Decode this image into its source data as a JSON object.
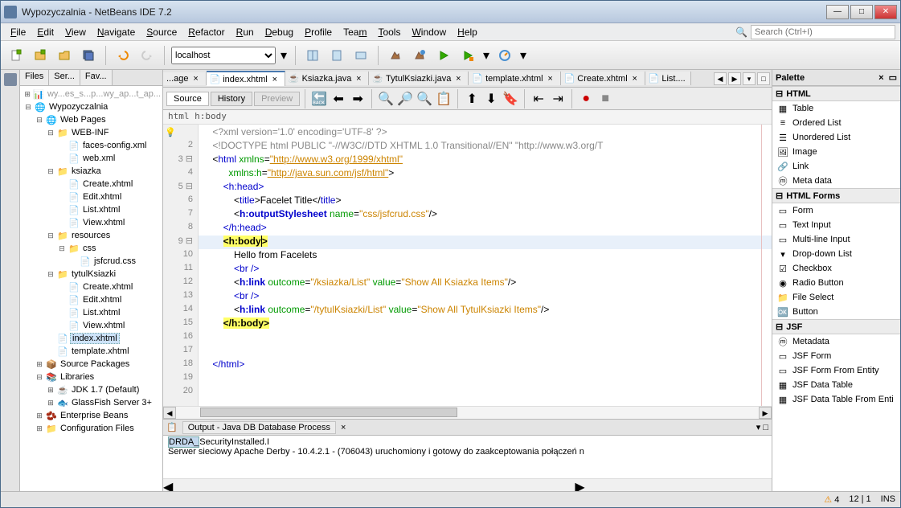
{
  "window": {
    "title": "Wypozyczalnia - NetBeans IDE 7.2"
  },
  "menu": [
    "File",
    "Edit",
    "View",
    "Navigate",
    "Source",
    "Refactor",
    "Run",
    "Debug",
    "Profile",
    "Team",
    "Tools",
    "Window",
    "Help"
  ],
  "search_placeholder": "Search (Ctrl+I)",
  "toolbar_config": "localhost",
  "project_tabs": [
    "Files",
    "Ser...",
    "Fav..."
  ],
  "tree": {
    "root_trunc": "... y.c. c._ep.ce ._ep.c_ep...",
    "root": "Wypozyczalnia",
    "webpages": "Web Pages",
    "webinf": "WEB-INF",
    "facesconfig": "faces-config.xml",
    "webxml": "web.xml",
    "ksiazka": "ksiazka",
    "create": "Create.xhtml",
    "edit": "Edit.xhtml",
    "list": "List.xhtml",
    "view": "View.xhtml",
    "resources": "resources",
    "css": "css",
    "jsfcrud": "jsfcrud.css",
    "tytul": "tytulKsiazki",
    "index": "index.xhtml",
    "template": "template.xhtml",
    "srcpkg": "Source Packages",
    "libs": "Libraries",
    "jdk": "JDK 1.7 (Default)",
    "gf": "GlassFish Server 3+",
    "eb": "Enterprise Beans",
    "cfg": "Configuration Files"
  },
  "editor_tabs": [
    "...age",
    "index.xhtml",
    "Ksiazka.java",
    "TytulKsiazki.java",
    "template.xhtml",
    "Create.xhtml",
    "List...."
  ],
  "editor_sub": {
    "source": "Source",
    "history": "History",
    "preview": "Preview"
  },
  "breadcrumb": "html   h:body",
  "code_lines": {
    "l1": "    <?xml version='1.0' encoding='UTF-8' ?>",
    "l2": "    <!DOCTYPE html PUBLIC \"-//W3C//DTD XHTML 1.0 Transitional//EN\" \"http://www.w3.org/T",
    "l3_a": "    <",
    "l3_tag": "html",
    "l3_b": " xmlns",
    "l3_c": "=",
    "l3_d": "\"http://www.w3.org/1999/xhtml\"",
    "l4_a": "          xmlns:h",
    "l4_b": "=",
    "l4_c": "\"http://java.sun.com/jsf/html\"",
    "l4_d": ">",
    "l5": "        <h:head>",
    "l6_a": "            <",
    "l6_tag": "title",
    "l6_b": ">Facelet Title</",
    "l6_tag2": "title",
    "l6_c": ">",
    "l7_a": "            <",
    "l7_tag": "h:outputStylesheet",
    "l7_b": " name",
    "l7_c": "=",
    "l7_d": "\"css/jsfcrud.css\"",
    "l7_e": "/>",
    "l8": "        </h:head>",
    "l9_a": "        ",
    "l9_hl": "<h:body̲>",
    "l10": "            Hello from Facelets",
    "l11": "            <br />",
    "l12_a": "            <",
    "l12_tag": "h:link",
    "l12_b": " outcome",
    "l12_c": "=",
    "l12_d": "\"/ksiazka/List\"",
    "l12_e": " value",
    "l12_f": "=",
    "l12_g": "\"Show All Ksiazka Items\"",
    "l12_h": "/>",
    "l13": "            <br />",
    "l14_a": "            <",
    "l14_tag": "h:link",
    "l14_b": " outcome",
    "l14_c": "=",
    "l14_d": "\"/tytulKsiazki/List\"",
    "l14_e": " value",
    "l14_f": "=",
    "l14_g": "\"Show All TytulKsiazki Items\"",
    "l14_h": "/>",
    "l15_hl": "</h:body>",
    "l18": "    </html>"
  },
  "output": {
    "title": "Output - Java DB Database Process",
    "l1_sel": "DRDA_",
    "l1_rest": "SecurityInstalled.I",
    "l2": "Serwer sieciowy Apache Derby - 10.4.2.1 - (706043) uruchomiony i gotowy do zaakceptowania połączeń n"
  },
  "palette": {
    "title": "Palette",
    "sec_html": "HTML",
    "items_html": [
      "Table",
      "Ordered List",
      "Unordered List",
      "Image",
      "Link",
      "Meta data"
    ],
    "sec_forms": "HTML Forms",
    "items_forms": [
      "Form",
      "Text Input",
      "Multi-line Input",
      "Drop-down List",
      "Checkbox",
      "Radio Button",
      "File Select",
      "Button"
    ],
    "sec_jsf": "JSF",
    "items_jsf": [
      "Metadata",
      "JSF Form",
      "JSF Form From Entity",
      "JSF Data Table",
      "JSF Data Table From Enti"
    ]
  },
  "status": {
    "warn": "4",
    "pos": "12 | 1",
    "ins": "INS"
  }
}
